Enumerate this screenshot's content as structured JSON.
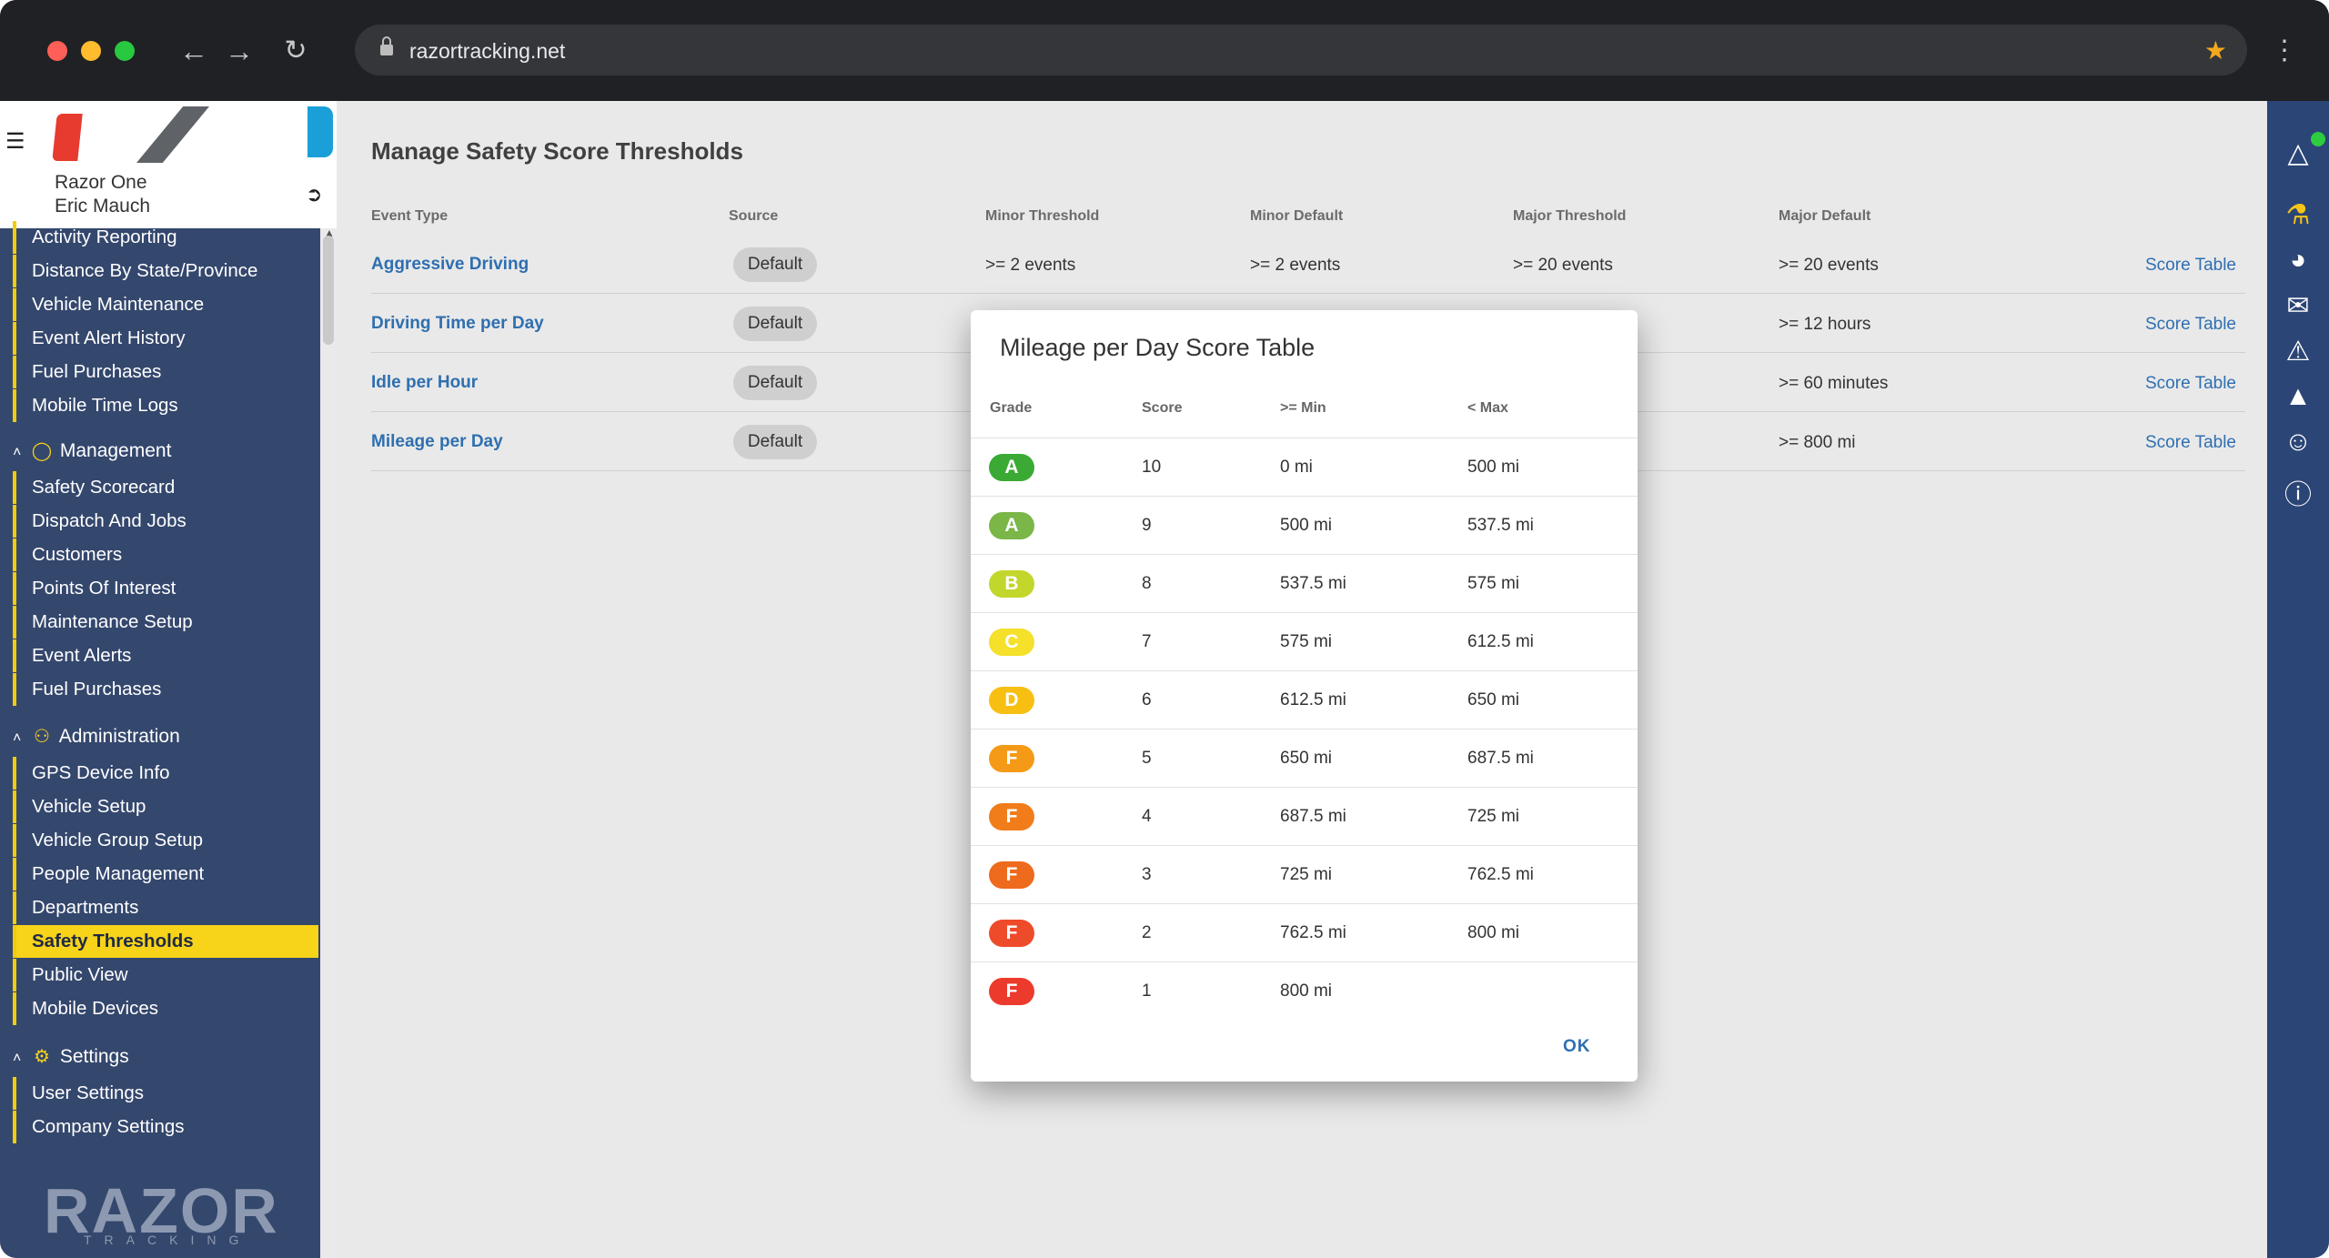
{
  "browser": {
    "url": "razortracking.net"
  },
  "sidebar": {
    "user_company": "Razor One",
    "user_name": "Eric Mauch",
    "items_top": [
      "Activity Reporting",
      "Distance By State/Province",
      "Vehicle Maintenance",
      "Event Alert History",
      "Fuel Purchases",
      "Mobile Time Logs"
    ],
    "section_management": "Management",
    "items_management": [
      "Safety Scorecard",
      "Dispatch And Jobs",
      "Customers",
      "Points Of Interest",
      "Maintenance Setup",
      "Event Alerts",
      "Fuel Purchases"
    ],
    "section_administration": "Administration",
    "items_administration": [
      "GPS Device Info",
      "Vehicle Setup",
      "Vehicle Group Setup",
      "People Management",
      "Departments",
      "Safety Thresholds",
      "Public View",
      "Mobile Devices"
    ],
    "section_settings": "Settings",
    "items_settings": [
      "User Settings",
      "Company Settings"
    ],
    "brand": "RAZOR",
    "brand_sub": "TRACKING"
  },
  "main": {
    "title": "Manage Safety Score Thresholds",
    "columns": [
      "Event Type",
      "Source",
      "Minor Threshold",
      "Minor Default",
      "Major Threshold",
      "Major Default"
    ],
    "rows": [
      {
        "event": "Aggressive Driving",
        "source": "Default",
        "minor_threshold": ">= 2 events",
        "minor_default": ">= 2 events",
        "major_threshold": ">= 20 events",
        "major_default": ">= 20 events",
        "link": "Score Table"
      },
      {
        "event": "Driving Time per Day",
        "source": "Default",
        "minor_threshold": "",
        "minor_default": "",
        "major_threshold": "",
        "major_default": ">= 12 hours",
        "link": "Score Table"
      },
      {
        "event": "Idle per Hour",
        "source": "Default",
        "minor_threshold": "",
        "minor_default": "",
        "major_threshold": "",
        "major_default": ">= 60 minutes",
        "link": "Score Table"
      },
      {
        "event": "Mileage per Day",
        "source": "Default",
        "minor_threshold": "",
        "minor_default": "",
        "major_threshold": "",
        "major_default": ">= 800 mi",
        "link": "Score Table"
      }
    ]
  },
  "modal": {
    "title": "Mileage per Day Score Table",
    "columns": [
      "Grade",
      "Score",
      ">= Min",
      "< Max"
    ],
    "rows": [
      {
        "grade": "A",
        "color": "#3aaa35",
        "score": "10",
        "min": "0 mi",
        "max": "500 mi"
      },
      {
        "grade": "A",
        "color": "#7ab648",
        "score": "9",
        "min": "500 mi",
        "max": "537.5 mi"
      },
      {
        "grade": "B",
        "color": "#c2d62b",
        "score": "8",
        "min": "537.5 mi",
        "max": "575 mi"
      },
      {
        "grade": "C",
        "color": "#f5e02a",
        "score": "7",
        "min": "575 mi",
        "max": "612.5 mi"
      },
      {
        "grade": "D",
        "color": "#f7bf12",
        "score": "6",
        "min": "612.5 mi",
        "max": "650 mi"
      },
      {
        "grade": "F",
        "color": "#f49a16",
        "score": "5",
        "min": "650 mi",
        "max": "687.5 mi"
      },
      {
        "grade": "F",
        "color": "#f07c1a",
        "score": "4",
        "min": "687.5 mi",
        "max": "725 mi"
      },
      {
        "grade": "F",
        "color": "#ee6a1c",
        "score": "3",
        "min": "725 mi",
        "max": "762.5 mi"
      },
      {
        "grade": "F",
        "color": "#ee4b2b",
        "score": "2",
        "min": "762.5 mi",
        "max": "800 mi"
      },
      {
        "grade": "F",
        "color": "#ec3a2c",
        "score": "1",
        "min": "800 mi",
        "max": ""
      }
    ],
    "ok_label": "OK"
  },
  "colors": {
    "sidebar_bg": "#34476d",
    "active_item": "#f7d31a",
    "link": "#2f6fb0",
    "rail_bg": "#2b4576"
  }
}
